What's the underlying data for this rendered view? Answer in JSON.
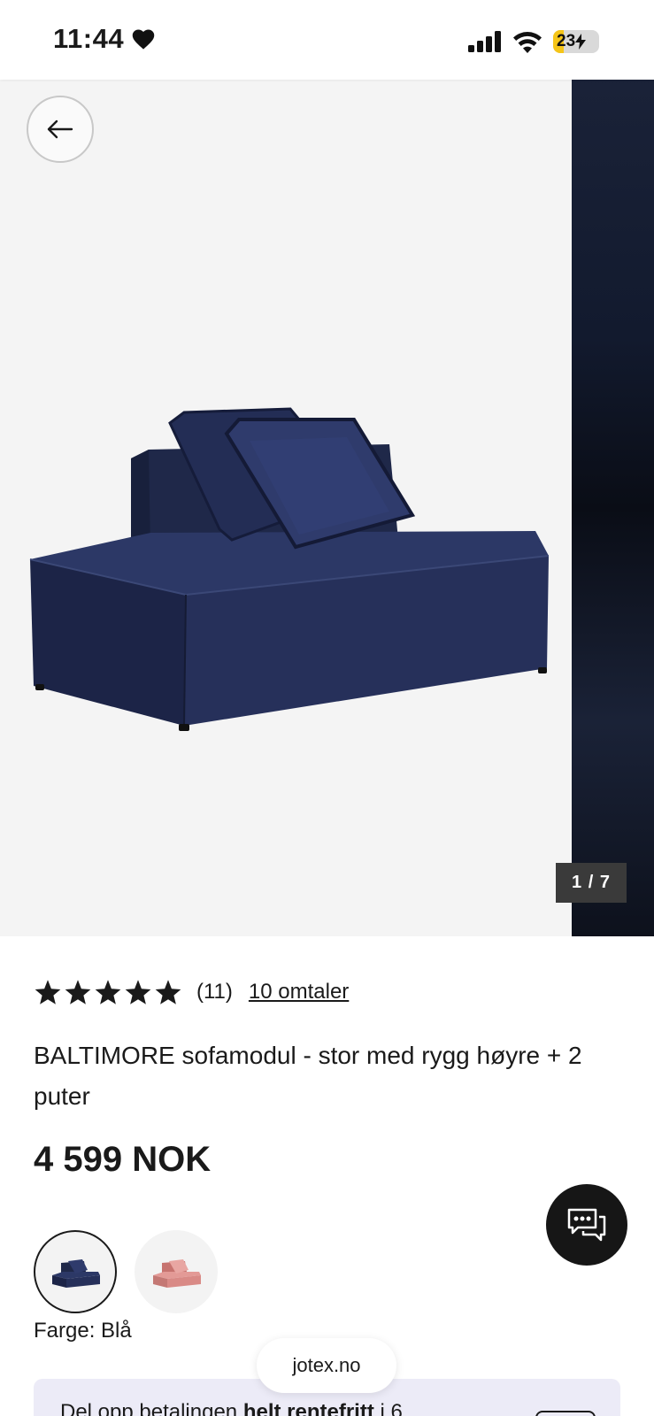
{
  "status_bar": {
    "time": "11:44",
    "battery_level": "23",
    "battery_fraction": 0.23,
    "icons": [
      "heart-icon",
      "signal-icon",
      "wifi-icon",
      "battery-charging-icon"
    ]
  },
  "gallery": {
    "counter": "1 / 7",
    "back_icon": "arrow-left-icon",
    "background_color": "#f4f4f4"
  },
  "product": {
    "rating_value": 5,
    "rating_count": "(11)",
    "reviews_link": "10 omtaler",
    "title": "BALTIMORE sofamodul - stor med rygg høyre + 2 puter",
    "price": "4 599 NOK",
    "color_label": "Farge: Blå",
    "swatches": [
      {
        "name": "Blå",
        "color": "#2b3a64",
        "selected": true
      },
      {
        "name": "Rosa",
        "color": "#d98a86",
        "selected": false
      }
    ]
  },
  "chat": {
    "icon": "chat-bubble-icon"
  },
  "browser": {
    "domain": "jotex.no"
  },
  "finance": {
    "text_before": "Del opp betalingen ",
    "text_bold": "helt rentefritt",
    "text_after": " i 6"
  },
  "colors": {
    "accent": "#161616",
    "sofa": "#27325a",
    "finance_bg": "#ecebf7",
    "star": "#1a1a1a"
  }
}
